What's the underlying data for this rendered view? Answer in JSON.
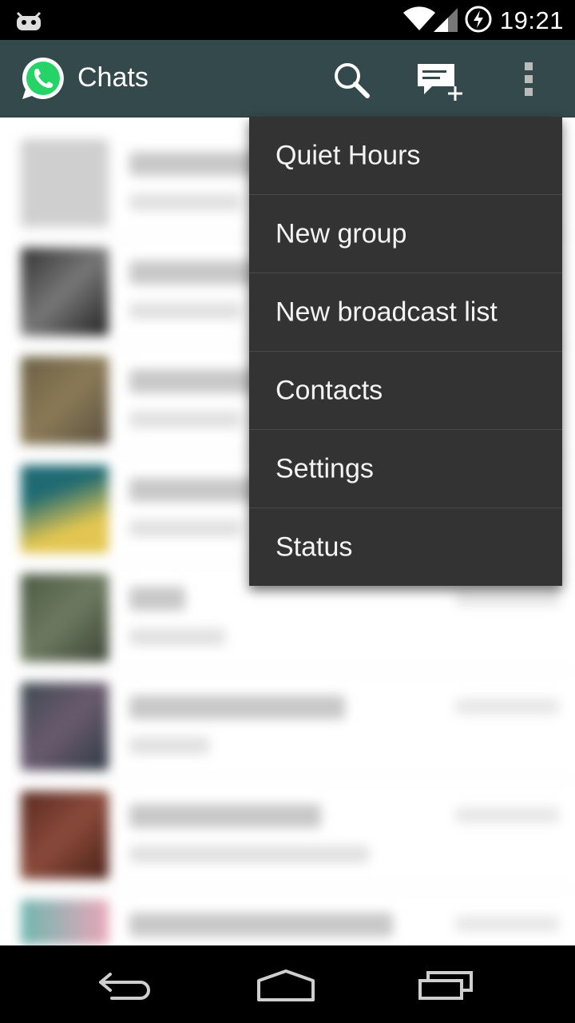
{
  "status_bar": {
    "time": "19:21",
    "icons": [
      "cyanogenmod-icon",
      "wifi-icon",
      "signal-icon",
      "battery-charging-icon"
    ]
  },
  "action_bar": {
    "title": "Chats",
    "icons": [
      "whatsapp-logo-icon",
      "search-icon",
      "new-chat-icon",
      "overflow-menu-icon"
    ]
  },
  "menu": {
    "items": [
      {
        "label": "Quiet Hours"
      },
      {
        "label": "New group"
      },
      {
        "label": "New broadcast list"
      },
      {
        "label": "Contacts"
      },
      {
        "label": "Settings"
      },
      {
        "label": "Status"
      }
    ]
  },
  "nav_bar": {
    "icons": [
      "back-icon",
      "home-icon",
      "recents-icon"
    ]
  },
  "colors": {
    "action_bar": "#34494b",
    "menu_background": "#333333",
    "whatsapp_green": "#25d366"
  }
}
